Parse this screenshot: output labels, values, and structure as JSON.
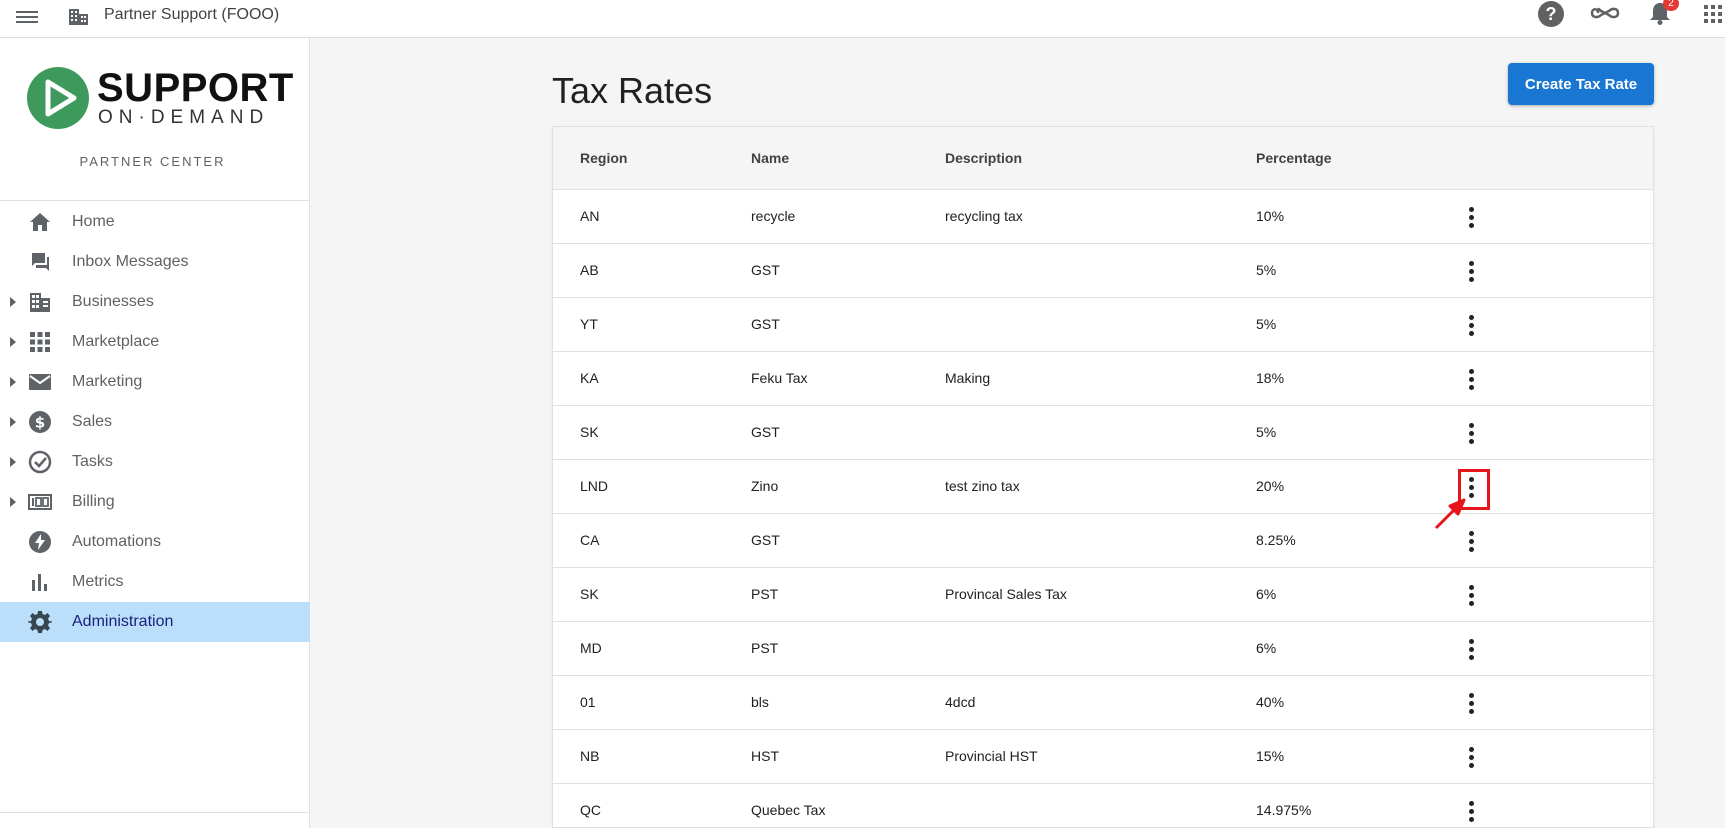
{
  "topbar": {
    "title": "Partner Support (FOOO)",
    "notification_count": "2",
    "icons": [
      "menu-icon",
      "building-icon",
      "help-icon",
      "infinity-icon",
      "bell-icon",
      "apps-icon"
    ]
  },
  "sidebar": {
    "logo_main": "SUPPORT",
    "logo_sub": "ON·DEMAND",
    "subtitle": "PARTNER CENTER",
    "items": [
      {
        "label": "Home",
        "icon": "home-icon",
        "expandable": false,
        "active": false
      },
      {
        "label": "Inbox Messages",
        "icon": "chat-icon",
        "expandable": false,
        "active": false
      },
      {
        "label": "Businesses",
        "icon": "building-icon",
        "expandable": true,
        "active": false
      },
      {
        "label": "Marketplace",
        "icon": "grid-icon",
        "expandable": true,
        "active": false
      },
      {
        "label": "Marketing",
        "icon": "mail-icon",
        "expandable": true,
        "active": false
      },
      {
        "label": "Sales",
        "icon": "dollar-icon",
        "expandable": true,
        "active": false
      },
      {
        "label": "Tasks",
        "icon": "check-circle-icon",
        "expandable": true,
        "active": false
      },
      {
        "label": "Billing",
        "icon": "billing-icon",
        "expandable": true,
        "active": false
      },
      {
        "label": "Automations",
        "icon": "bolt-icon",
        "expandable": false,
        "active": false
      },
      {
        "label": "Metrics",
        "icon": "bar-chart-icon",
        "expandable": false,
        "active": false
      },
      {
        "label": "Administration",
        "icon": "gear-icon",
        "expandable": false,
        "active": true
      }
    ],
    "active_color": "#bbdefb"
  },
  "main": {
    "title": "Tax Rates",
    "create_button": "Create Tax Rate",
    "accent_color": "#1976d2",
    "table": {
      "headers": {
        "region": "Region",
        "name": "Name",
        "description": "Description",
        "percentage": "Percentage"
      },
      "rows": [
        {
          "region": "AN",
          "name": "recycle",
          "description": "recycling tax",
          "percentage": "10%"
        },
        {
          "region": "AB",
          "name": "GST",
          "description": "",
          "percentage": "5%"
        },
        {
          "region": "YT",
          "name": "GST",
          "description": "",
          "percentage": "5%"
        },
        {
          "region": "KA",
          "name": "Feku Tax",
          "description": "Making",
          "percentage": "18%"
        },
        {
          "region": "SK",
          "name": "GST",
          "description": "",
          "percentage": "5%"
        },
        {
          "region": "LND",
          "name": "Zino",
          "description": "test zino tax",
          "percentage": "20%"
        },
        {
          "region": "CA",
          "name": "GST",
          "description": "",
          "percentage": "8.25%"
        },
        {
          "region": "SK",
          "name": "PST",
          "description": "Provincal Sales Tax",
          "percentage": "6%"
        },
        {
          "region": "MD",
          "name": "PST",
          "description": "",
          "percentage": "6%"
        },
        {
          "region": "01",
          "name": "bls",
          "description": "4dcd",
          "percentage": "40%"
        },
        {
          "region": "NB",
          "name": "HST",
          "description": "Provincial HST",
          "percentage": "15%"
        },
        {
          "region": "QC",
          "name": "Quebec Tax",
          "description": "",
          "percentage": "14.975%"
        }
      ]
    },
    "annotation_color": "#e8141b"
  }
}
